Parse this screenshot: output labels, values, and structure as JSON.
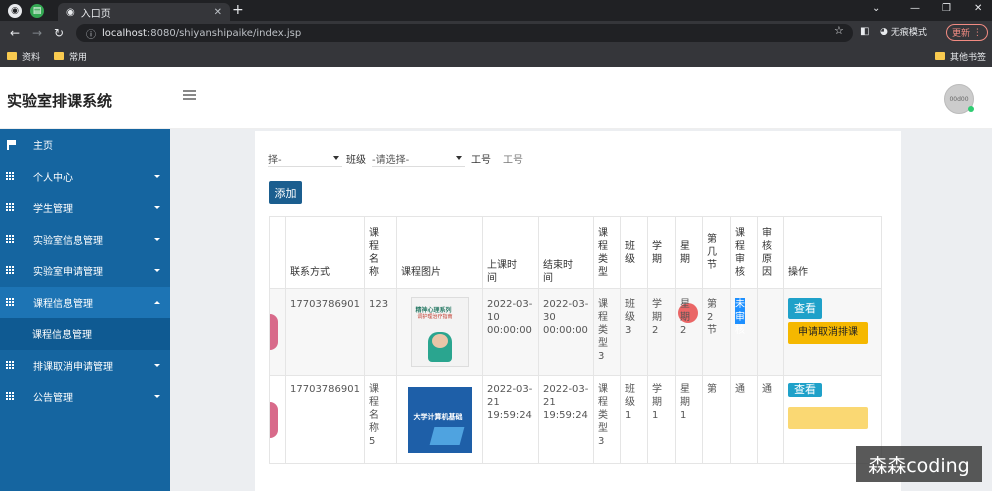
{
  "browser": {
    "tab_title": "入口页",
    "url_host": "localhost",
    "url_rest": ":8080/shiyanshipaike/index.jsp",
    "incognito_label": "无痕模式",
    "update_label": "更新",
    "bookmarks": [
      "资料",
      "常用"
    ],
    "other_bookmarks": "其他书签"
  },
  "header": {
    "title": "实验室排课系统",
    "avatar_text": "00d00"
  },
  "sidebar": {
    "items": [
      {
        "label": "主页",
        "icon": "flag-icon"
      },
      {
        "label": "个人中心",
        "icon": "grid-icon"
      },
      {
        "label": "学生管理",
        "icon": "grid-icon"
      },
      {
        "label": "实验室信息管理",
        "icon": "grid-icon"
      },
      {
        "label": "实验室申请管理",
        "icon": "grid-icon"
      },
      {
        "label": "课程信息管理",
        "icon": "grid-icon"
      },
      {
        "label": "课程信息管理"
      },
      {
        "label": "排课取消申请管理",
        "icon": "grid-icon"
      },
      {
        "label": "公告管理",
        "icon": "grid-icon"
      }
    ]
  },
  "filters": {
    "select1": "择-",
    "class_label": "班级",
    "select2": "-请选择-",
    "job_label": "工号",
    "job_placeholder": "工号"
  },
  "add_button": "添加",
  "table": {
    "headers": [
      "联系方式",
      "课程名称",
      "课程图片",
      "上课时间",
      "结束时间",
      "课程类型",
      "班级",
      "学期",
      "星期",
      "第几节",
      "课程审核",
      "审核原因",
      "操作"
    ],
    "rows": [
      {
        "phone": "17703786901",
        "name": "123",
        "image": "book-cover-psychology",
        "start_date": "2022-03-10",
        "start_time": "00:00:00",
        "end_date": "2022-03-30",
        "end_time": "00:00:00",
        "type": "课程类型3",
        "class": "班级3",
        "term": "学期2",
        "week": "星期2",
        "period": "第2节",
        "audit": "未审核",
        "reason": "",
        "view": "查看",
        "cancel": "申请取消排课"
      },
      {
        "phone": "17703786901",
        "name": "课程名称5",
        "image": "book-cover-computer",
        "start_date": "2022-03-21",
        "start_time": "19:59:24",
        "end_date": "2022-03-21",
        "end_time": "19:59:24",
        "type": "课程类型3",
        "class": "班级1",
        "term": "学期1",
        "week": "星期1",
        "period": "第",
        "audit": "通",
        "reason": "通",
        "view": "查看",
        "cancel": ""
      }
    ]
  },
  "book1": {
    "title": "精神心理系列",
    "subtitle": "调护理治疗指南"
  },
  "book2": {
    "title": "大学计算机基础"
  },
  "watermark": "森森coding"
}
